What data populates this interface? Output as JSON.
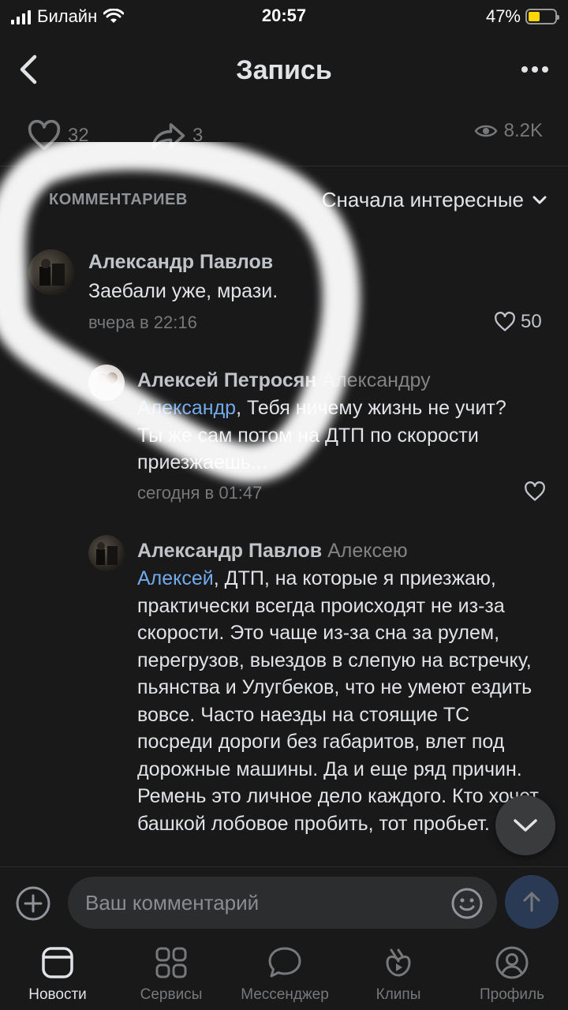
{
  "status_bar": {
    "carrier": "Билайн",
    "time": "20:57",
    "battery": "47%"
  },
  "header": {
    "title": "Запись"
  },
  "stats": {
    "likes": "32",
    "shares": "3",
    "views": "8.2K"
  },
  "comments_header": {
    "count_label": "КОММЕНТАРИЕВ",
    "sort_label": "Сначала интересные"
  },
  "comments": [
    {
      "author": "Александр Павлов",
      "reply_to": "",
      "mention": "",
      "text": "Заебали уже, мрази.",
      "time": "вчера в 22:16",
      "likes": "50"
    },
    {
      "author": "Алексей Петросян",
      "reply_to": "Александру",
      "mention": "Александр",
      "text": ", Тебя ничему жизнь не учит?Ты же сам потом на ДТП по скорости приезжаешь...",
      "time": "сегодня в 01:47",
      "likes": ""
    },
    {
      "author": "Александр Павлов",
      "reply_to": "Алексею",
      "mention": "Алексей",
      "text": ", ДТП, на которые я приезжаю, практически всегда происходят не из-за скорости. Это чаще из-за сна за рулем, перегрузов, выездов в слепую на встречку, пьянства и Улугбеков, что не умеют ездить вовсе. Часто наезды на стоящие ТС посреди дороги без габаритов, влет под дорожные машины. Да и еще ряд причин. Ремень это личное дело каждого. Кто хочет башкой лобовое пробить, тот пробьет.",
      "time": "",
      "likes": ""
    }
  ],
  "composer": {
    "placeholder": "Ваш комментарий"
  },
  "tabbar": {
    "items": [
      {
        "label": "Новости",
        "icon": "news-icon",
        "active": true
      },
      {
        "label": "Сервисы",
        "icon": "services-icon",
        "active": false
      },
      {
        "label": "Мессенджер",
        "icon": "messenger-icon",
        "active": false
      },
      {
        "label": "Клипы",
        "icon": "clips-icon",
        "active": false
      },
      {
        "label": "Профиль",
        "icon": "profile-icon",
        "active": false
      }
    ]
  },
  "colors": {
    "background": "#19191a",
    "link": "#71aaeb",
    "secondary": "#76787a",
    "battery": "#ffd60a"
  }
}
